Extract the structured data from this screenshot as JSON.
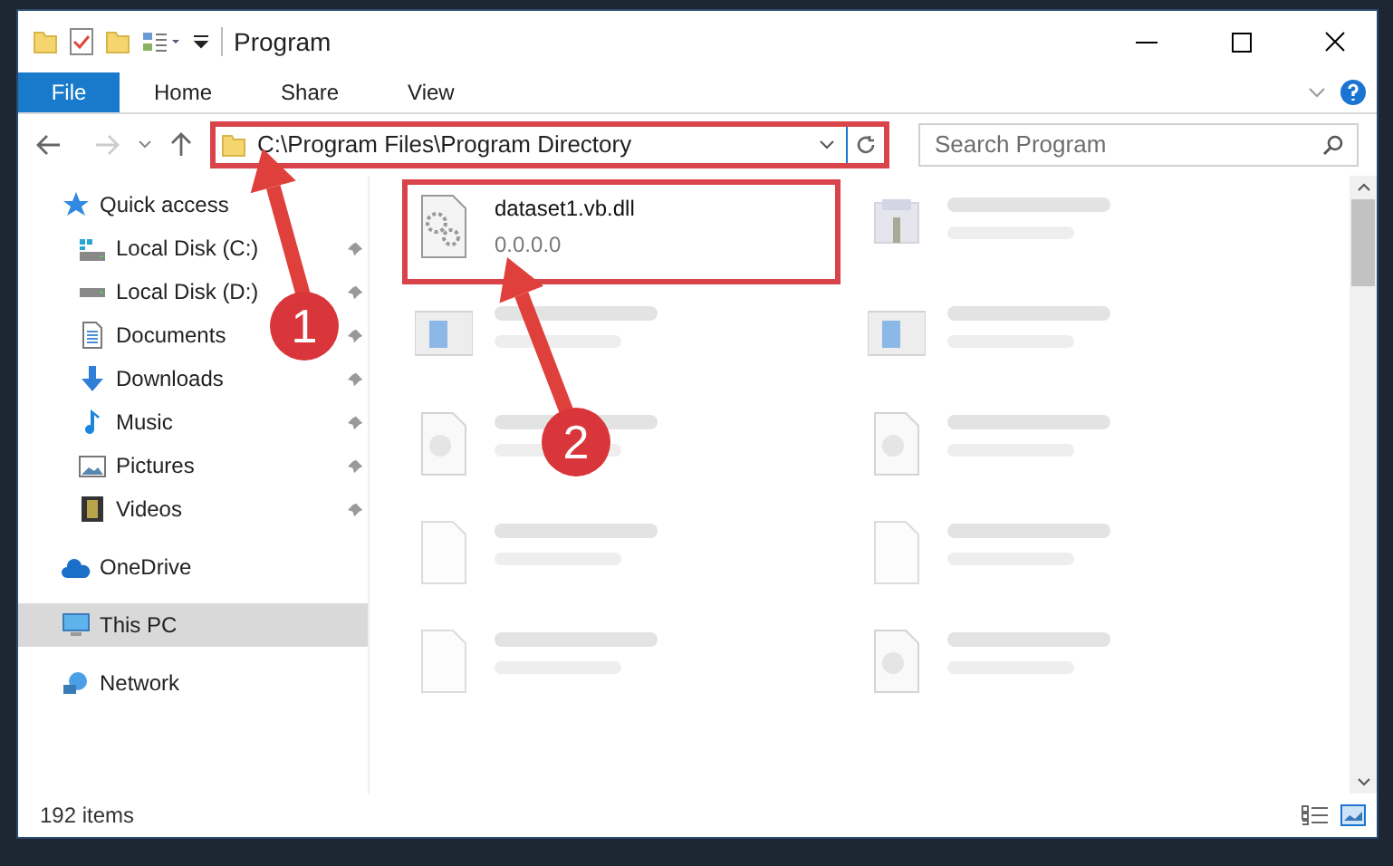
{
  "window": {
    "title": "Program"
  },
  "ribbon_tabs": [
    {
      "label": "File",
      "selected": true
    },
    {
      "label": "Home",
      "selected": false
    },
    {
      "label": "Share",
      "selected": false
    },
    {
      "label": "View",
      "selected": false
    }
  ],
  "address_bar": {
    "path": "C:\\Program Files\\Program Directory"
  },
  "search": {
    "placeholder": "Search Program"
  },
  "sidebar": {
    "items": [
      {
        "label": "Quick access",
        "selected": false,
        "children": [
          {
            "label": "Local Disk (C:)",
            "selected": false,
            "pinned": true
          },
          {
            "label": "Local Disk (D:)",
            "selected": false,
            "pinned": true
          },
          {
            "label": "Documents",
            "selected": false,
            "pinned": true
          },
          {
            "label": "Downloads",
            "selected": false,
            "pinned": true
          },
          {
            "label": "Music",
            "selected": false,
            "pinned": true
          },
          {
            "label": "Pictures",
            "selected": false,
            "pinned": true
          },
          {
            "label": "Videos",
            "selected": false,
            "pinned": true
          }
        ]
      },
      {
        "label": "OneDrive",
        "selected": false
      },
      {
        "label": "This PC",
        "selected": true
      },
      {
        "label": "Network",
        "selected": false
      }
    ]
  },
  "files": [
    {
      "kind": "file",
      "name": "dataset1.vb.dll",
      "detail": "0.0.0.0",
      "highlighted": true
    },
    {
      "kind": "blurred",
      "highlighted": false
    },
    {
      "kind": "blurred",
      "highlighted": false
    },
    {
      "kind": "blurred",
      "highlighted": false
    },
    {
      "kind": "blurred",
      "highlighted": false
    },
    {
      "kind": "blurred",
      "highlighted": false
    },
    {
      "kind": "blurred",
      "highlighted": false
    },
    {
      "kind": "blurred",
      "highlighted": false
    },
    {
      "kind": "blurred",
      "highlighted": false
    },
    {
      "kind": "blurred",
      "highlighted": false
    }
  ],
  "status_bar": {
    "item_count": "192 items"
  },
  "annotations": [
    {
      "number": "1"
    },
    {
      "number": "2"
    }
  ]
}
